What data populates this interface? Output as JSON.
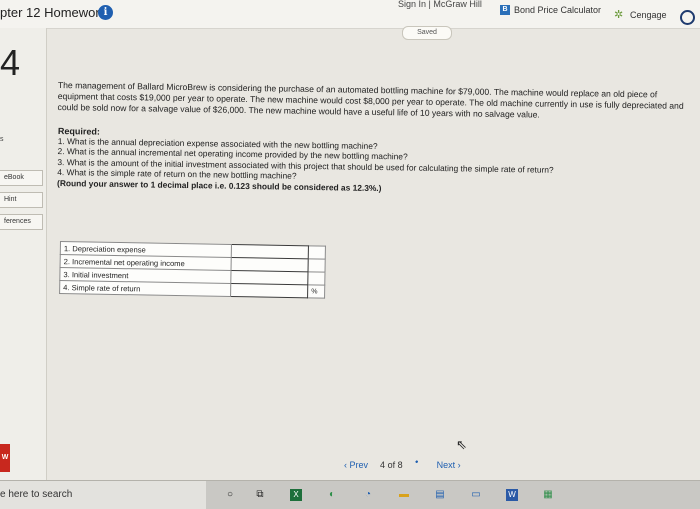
{
  "header": {
    "chapter_title": "pter 12 Homework",
    "info_label": "i",
    "top_links_label": "Sign In | McGraw Hill",
    "bond_icon_label": "B",
    "bond_label": "Bond Price Calculator",
    "cengage_label": "Cengage",
    "saved_label": "Saved"
  },
  "sidebar": {
    "question_number": "4",
    "points_label": "s",
    "ebook_label": "eBook",
    "hint_label": "Hint",
    "references_label": "ferences",
    "brand_letter": "W"
  },
  "problem": {
    "text": "The management of Ballard MicroBrew is considering the purchase of an automated bottling machine for $79,000. The machine would replace an old piece of equipment that costs $19,000 per year to operate. The new machine would cost $8,000 per year to operate. The old machine currently in use is fully depreciated and could be sold now for a salvage value of $26,000. The new machine would have a useful life of 10 years with no salvage value."
  },
  "required": {
    "title": "Required:",
    "items": [
      "1. What is the annual depreciation expense associated with the new bottling machine?",
      "2. What is the annual incremental net operating income provided by the new bottling machine?",
      "3. What is the amount of the initial investment associated with this project that should be used for calculating the simple rate of return?",
      "4. What is the simple rate of return on the new bottling machine?"
    ],
    "round_note": "(Round your answer to 1 decimal place i.e. 0.123 should be considered as 12.3%.)"
  },
  "answer_table": {
    "rows": [
      {
        "label": "1. Depreciation expense",
        "value": "",
        "unit": ""
      },
      {
        "label": "2. Incremental net operating income",
        "value": "",
        "unit": ""
      },
      {
        "label": "3. Initial investment",
        "value": "",
        "unit": ""
      },
      {
        "label": "4. Simple rate of return",
        "value": "",
        "unit": "%"
      }
    ]
  },
  "navigation": {
    "prev_label": "Prev",
    "page_current": "4",
    "page_of": "of",
    "page_total": "8",
    "next_label": "Next"
  },
  "taskbar": {
    "search_label": "e here to search"
  },
  "colors": {
    "accent": "#1f5fb0",
    "brand_red": "#c8281e"
  }
}
